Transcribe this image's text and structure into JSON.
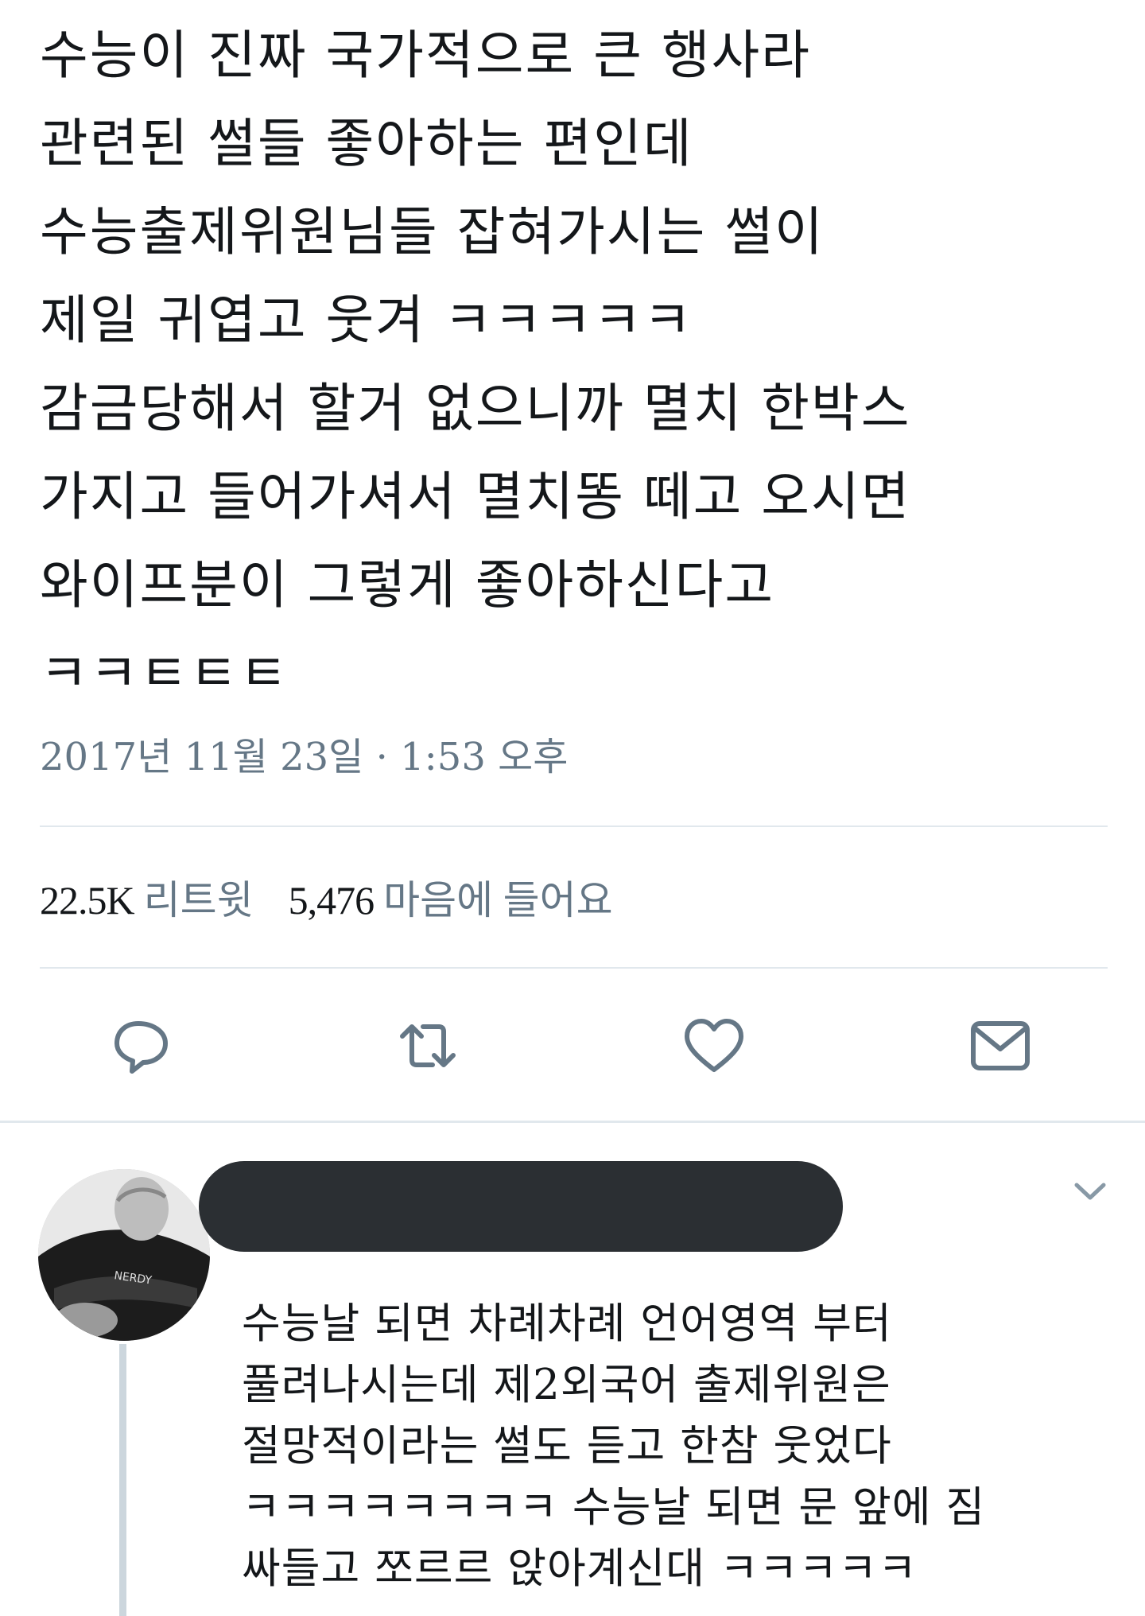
{
  "tweet": {
    "lines": [
      "수능이 진짜 국가적으로 큰 행사라",
      "관련된 썰들 좋아하는 편인데",
      "수능출제위원님들 잡혀가시는 썰이",
      "제일 귀엽고 웃겨 ㅋㅋㅋㅋㅋ",
      "감금당해서 할거 없으니까 멸치 한박스",
      "가지고 들어가셔서 멸치똥 떼고 오시면",
      "와이프분이 그렇게 좋아하신다고",
      "ㅋㅋㅌㅌㅌ"
    ],
    "timestamp": "2017년 11월 23일 · 1:53 오후",
    "retweets_count": "22.5K",
    "retweets_label": "리트윗",
    "likes_count": "5,476",
    "likes_label": "마음에 들어요"
  },
  "actions": {
    "icons": [
      "reply-icon",
      "retweet-icon",
      "like-icon",
      "direct-message-icon"
    ]
  },
  "reply": {
    "author_redacted": true,
    "lines": [
      "수능날 되면 차례차례 언어영역 부터",
      "풀려나시는데 제2외국어 출제위원은",
      "절망적이라는 썰도 듣고 한참 웃었다",
      "ㅋㅋㅋㅋㅋㅋㅋㅋ 수능날 되면 문 앞에 짐",
      "싸들고 쪼르르 앉아계신대 ㅋㅋㅋㅋㅋ"
    ]
  },
  "colors": {
    "text": "#14171a",
    "secondary": "#657786",
    "divider": "#e1e8ed",
    "icon": "#657786",
    "redaction": "#2b2f33"
  }
}
